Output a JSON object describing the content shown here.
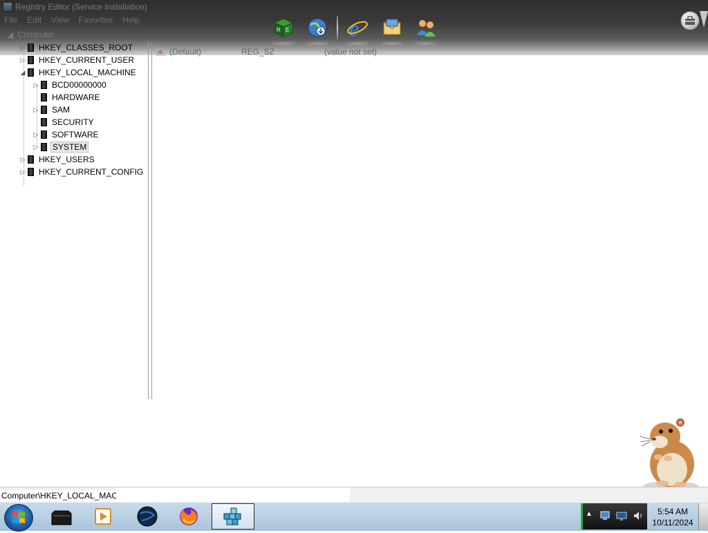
{
  "window": {
    "title": "Registry Editor (Service Installation)",
    "menu": [
      "File",
      "Edit",
      "View",
      "Favorites",
      "Help"
    ]
  },
  "dock": {
    "items": [
      {
        "name": "regedit-launcher-icon"
      },
      {
        "name": "network-globe-icon"
      },
      {
        "name": "internet-explorer-icon"
      },
      {
        "name": "mail-envelope-icon"
      },
      {
        "name": "users-icon"
      }
    ]
  },
  "tree": {
    "root": "Computer",
    "nodes": [
      {
        "label": "HKEY_CLASSES_ROOT",
        "expander": "▷"
      },
      {
        "label": "HKEY_CURRENT_USER",
        "expander": "▷"
      },
      {
        "label": "HKEY_LOCAL_MACHINE",
        "expander": "◢"
      },
      {
        "label": "BCD00000000",
        "expander": "▷"
      },
      {
        "label": "HARDWARE",
        "expander": ""
      },
      {
        "label": "SAM",
        "expander": "▷"
      },
      {
        "label": "SECURITY",
        "expander": ""
      },
      {
        "label": "SOFTWARE",
        "expander": "▷"
      },
      {
        "label": "SYSTEM",
        "expander": "▷"
      },
      {
        "label": "HKEY_USERS",
        "expander": "▷"
      },
      {
        "label": "HKEY_CURRENT_CONFIG",
        "expander": "▷"
      }
    ]
  },
  "values": {
    "rows": [
      {
        "name": "(Default)",
        "type": "REG_SZ",
        "data": "(value not set)"
      }
    ]
  },
  "status": {
    "path": "Computer\\HKEY_LOCAL_MACHINE"
  },
  "taskbar": {
    "items": [
      {
        "name": "black-app-icon"
      },
      {
        "name": "media-player-icon"
      },
      {
        "name": "globe-app-icon"
      },
      {
        "name": "firefox-icon"
      },
      {
        "name": "regedit-icon"
      }
    ],
    "clock": {
      "time": "5:54 AM",
      "date": "10/11/2024"
    },
    "tray_up": "▲"
  },
  "colors": {
    "taskbar_top": "#c9dbea",
    "taskbar_bottom": "#a9c3da",
    "tray_accent": "#2cab3a"
  }
}
